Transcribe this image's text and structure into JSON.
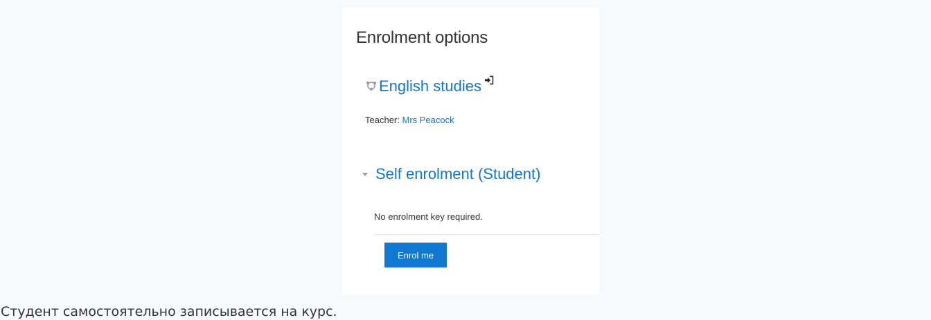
{
  "page": {
    "title": "Enrolment options",
    "caption": "Студент самостоятельно записывается на курс."
  },
  "course": {
    "name": "English studies",
    "teacher_label": "Teacher: ",
    "teacher_name": "Mrs Peacock"
  },
  "self_enrolment": {
    "title": "Self enrolment (Student)",
    "message": "No enrolment key required.",
    "button_label": "Enrol me"
  },
  "icons": {
    "course": "course-icon",
    "login": "login-icon",
    "expand": "caret-down-icon"
  },
  "colors": {
    "link": "#1177d1",
    "button": "#1177d1",
    "background": "#f8f9fa"
  }
}
